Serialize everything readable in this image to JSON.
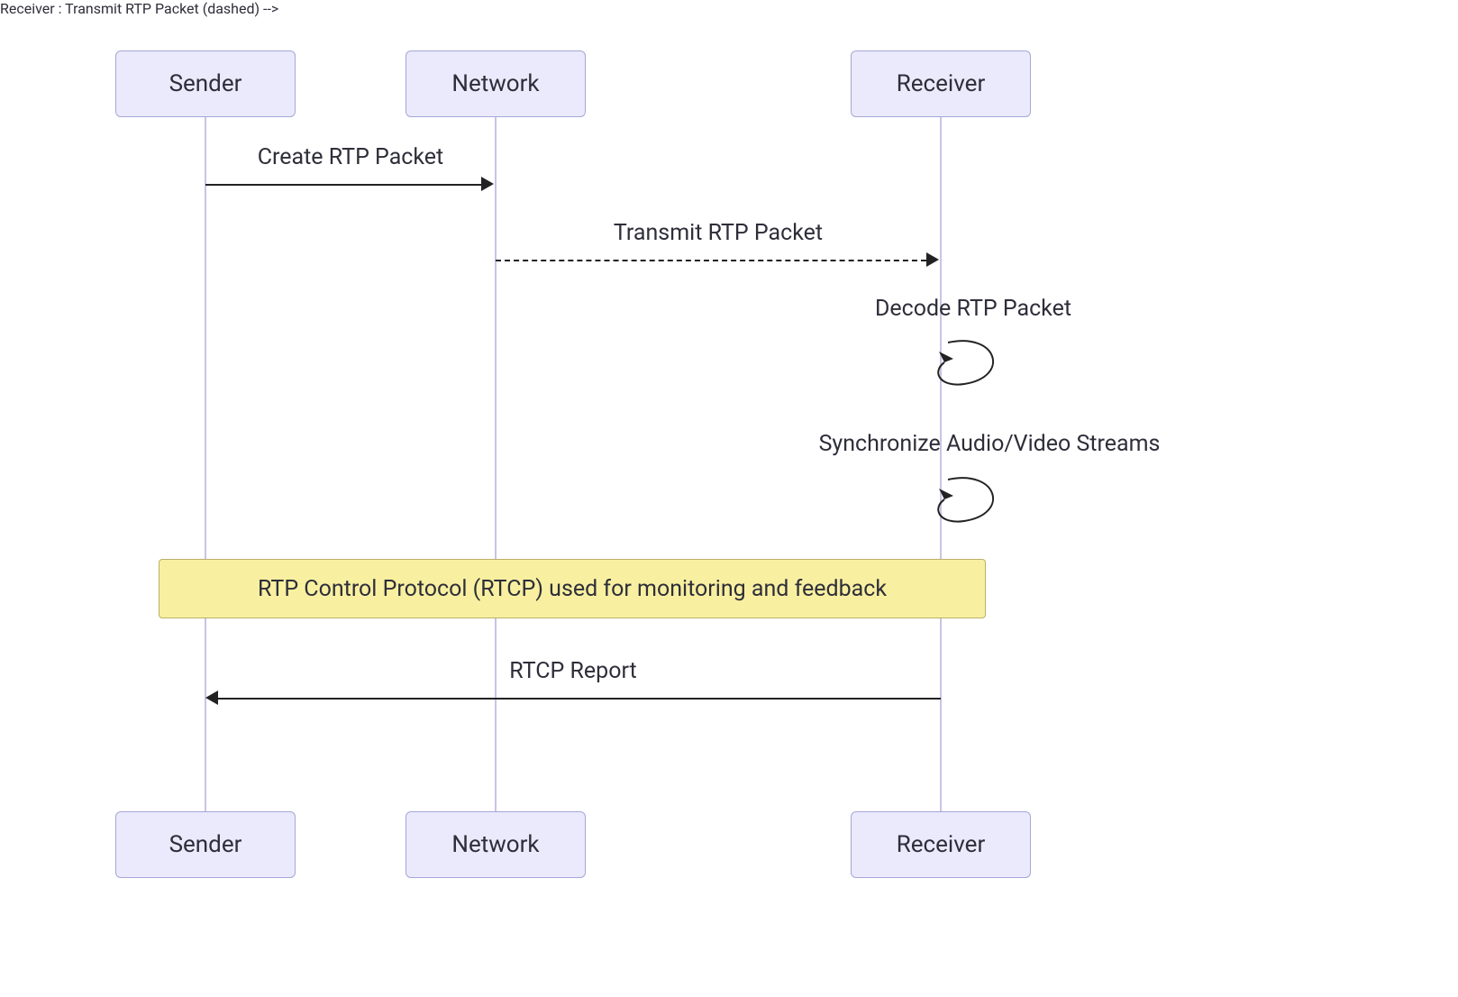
{
  "actors": {
    "sender": "Sender",
    "network": "Network",
    "receiver": "Receiver"
  },
  "messages": {
    "create_rtp": "Create RTP Packet",
    "transmit_rtp": "Transmit RTP Packet",
    "decode_rtp": "Decode RTP Packet",
    "sync_streams": "Synchronize Audio/Video Streams",
    "rtcp_report": "RTCP Report"
  },
  "note": "RTP Control Protocol (RTCP) used for monitoring and feedback",
  "chart_data": {
    "type": "sequence-diagram",
    "participants": [
      "Sender",
      "Network",
      "Receiver"
    ],
    "steps": [
      {
        "from": "Sender",
        "to": "Network",
        "label": "Create RTP Packet",
        "style": "solid"
      },
      {
        "from": "Network",
        "to": "Receiver",
        "label": "Transmit RTP Packet",
        "style": "dashed"
      },
      {
        "from": "Receiver",
        "to": "Receiver",
        "label": "Decode RTP Packet",
        "style": "self"
      },
      {
        "from": "Receiver",
        "to": "Receiver",
        "label": "Synchronize Audio/Video Streams",
        "style": "self"
      },
      {
        "note_over": [
          "Sender",
          "Receiver"
        ],
        "text": "RTP Control Protocol (RTCP) used for monitoring and feedback"
      },
      {
        "from": "Receiver",
        "to": "Sender",
        "label": "RTCP Report",
        "style": "solid"
      }
    ]
  }
}
